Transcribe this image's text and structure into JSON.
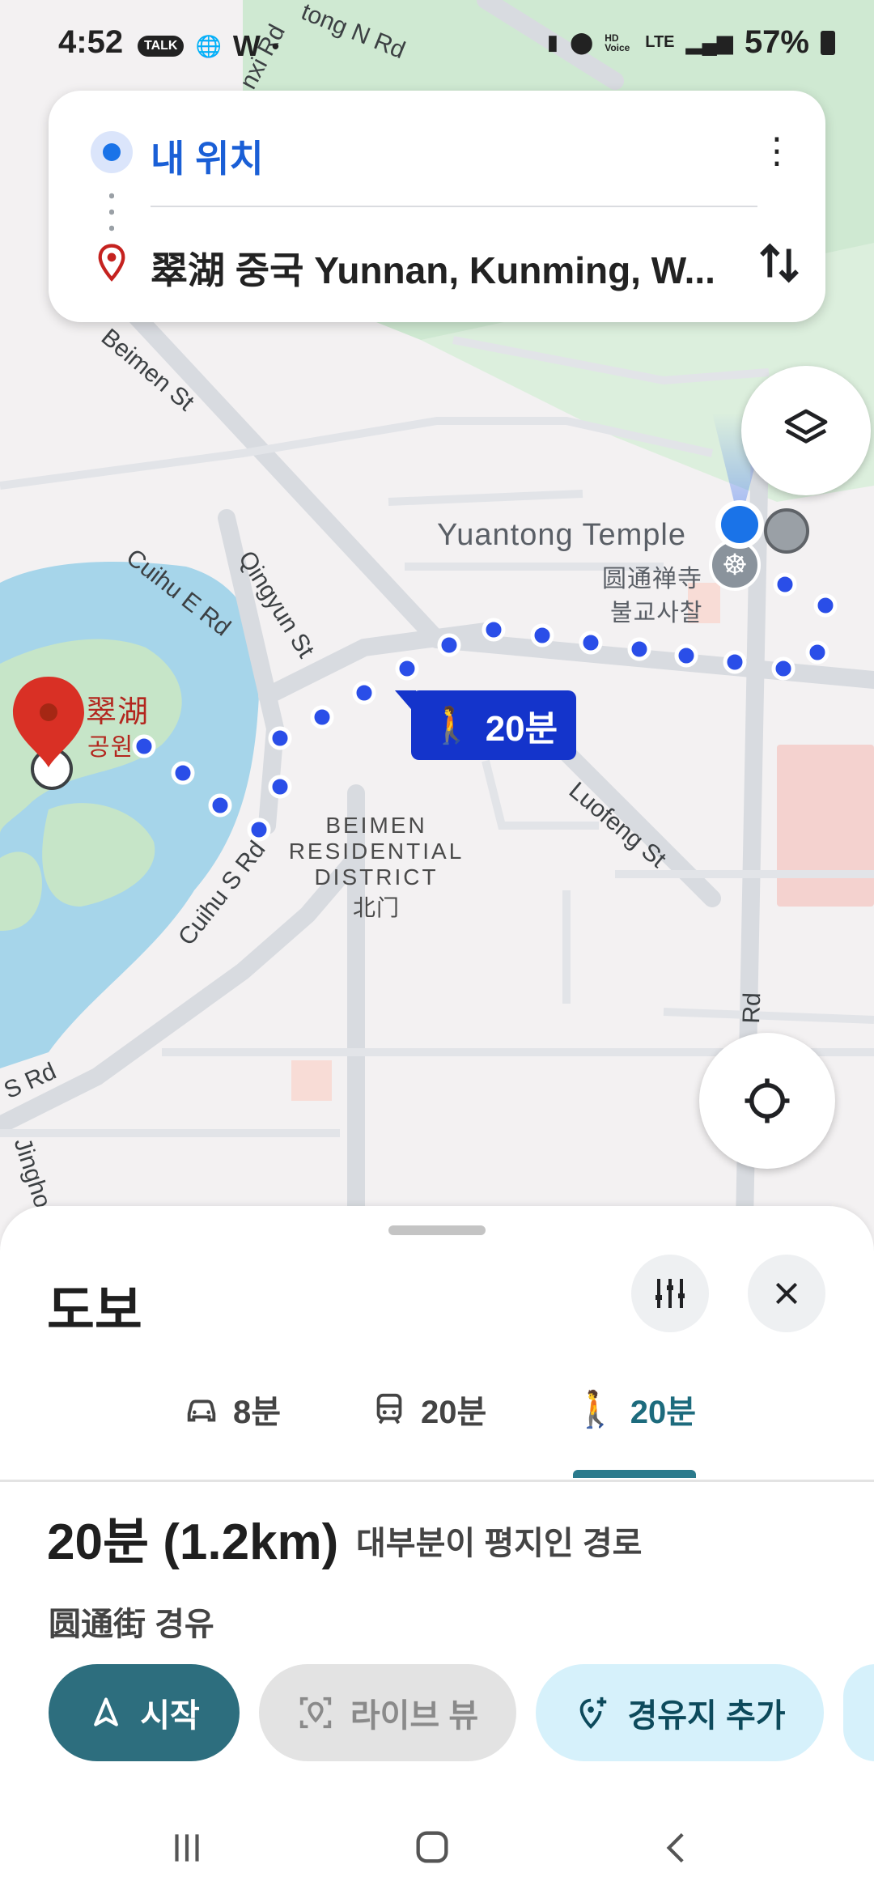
{
  "status_bar": {
    "time": "4:52",
    "notif_talk": "TALK",
    "hd_voice": "HD Voice",
    "network": "LTE",
    "battery": "57%"
  },
  "route_card": {
    "origin": "내 위치",
    "destination": "翠湖 중국 Yunnan, Kunming, W..."
  },
  "map": {
    "labels": {
      "yuantong_temple": "Yuantong Temple",
      "yuantong_cn": "圆通禅寺",
      "yuantong_kr": "불교사찰",
      "cuihu_cn": "翠湖",
      "cuihu_kr": "공원",
      "district_line1": "BEIMEN",
      "district_line2": "RESIDENTIAL",
      "district_line3": "DISTRICT",
      "district_cn": "北门"
    },
    "streets": {
      "tong_n": "tong N Rd",
      "nxi": "nxi Rd",
      "beimen": "Beimen St",
      "cuihu_e": "Cuihu E Rd",
      "qingyun": "Qingyun St",
      "luofeng": "Luofeng St",
      "cuihu_s": "Cuihu S Rd",
      "s_rd": "S Rd",
      "jingho": "Jingho",
      "rd_right": "Rd"
    },
    "walk_badge": "20분"
  },
  "sheet": {
    "title": "도보",
    "tabs": [
      {
        "icon": "car-icon",
        "label": "8분"
      },
      {
        "icon": "transit-icon",
        "label": "20분"
      },
      {
        "icon": "walk-icon",
        "label": "20분"
      }
    ],
    "route_time": "20분 (1.2km)",
    "route_desc": "대부분이 평지인 경로",
    "route_via": "圆通街 경유",
    "buttons": {
      "start": "시작",
      "live_view": "라이브 뷰",
      "add_stop": "경유지 추가"
    }
  },
  "colors": {
    "route_dot": "#2a4ee8",
    "accent_teal": "#2d6e7e",
    "origin_blue": "#1a73e8",
    "badge_blue": "#1434cb",
    "water": "#a6d5ea",
    "park": "#c9e7cf"
  }
}
